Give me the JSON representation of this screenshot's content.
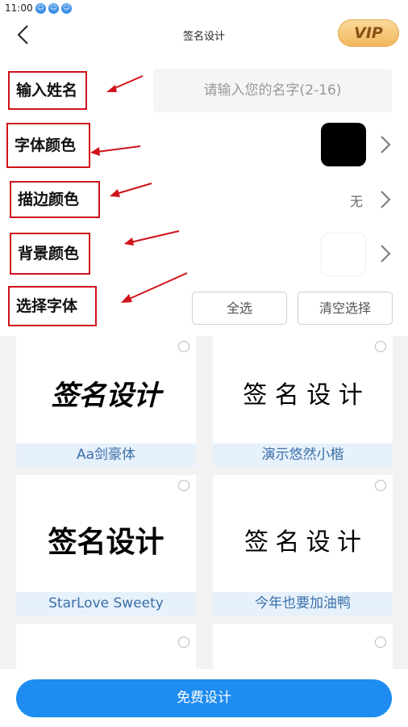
{
  "status": {
    "time": "11:00",
    "icons": [
      "notification-icon-1",
      "notification-icon-2",
      "notification-icon-3"
    ]
  },
  "header": {
    "back_icon": "back-arrow-icon",
    "title": "签名设计",
    "vip_label": "VIP"
  },
  "form": {
    "name_label": "输入姓名",
    "name_placeholder": "请输入您的名字(2-16)",
    "font_color_label": "字体颜色",
    "font_color": "#000000",
    "stroke_color_label": "描边颜色",
    "stroke_color_value": "无",
    "bg_color_label": "背景颜色",
    "bg_color": "#ffffff",
    "font_select_label": "选择字体",
    "select_all": "全选",
    "clear_selection": "清空选择"
  },
  "fonts": [
    {
      "name": "Aa剑豪体",
      "sample": "签名设计"
    },
    {
      "name": "演示悠然小楷",
      "sample": "签 名 设 计"
    },
    {
      "name": "StarLove Sweety",
      "sample": "签名设计"
    },
    {
      "name": "今年也要加油鸭",
      "sample": "签 名 设 计"
    },
    {
      "name": "",
      "sample": ""
    },
    {
      "name": "",
      "sample": ""
    }
  ],
  "bottom": {
    "button_label": "免费设计"
  },
  "colors": {
    "annotation_red": "#d0121b",
    "accent_blue": "#1e8cf0",
    "caption_blue": "#3a6fa8"
  }
}
